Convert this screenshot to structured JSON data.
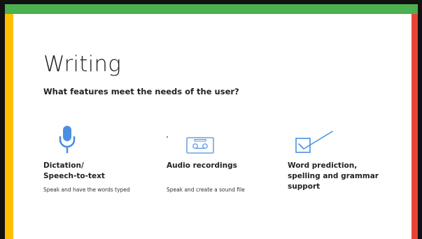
{
  "slide": {
    "title": "Writing",
    "subtitle": "What features meet the needs of the user?"
  },
  "features": [
    {
      "icon": "microphone-icon",
      "title_line1": "Dictation/",
      "title_line2": "Speech-to-text",
      "description": "Speak and have the words typed"
    },
    {
      "icon": "cassette-icon",
      "title_line1": "Audio recordings",
      "title_line2": "",
      "description": "Speak and create a sound file"
    },
    {
      "icon": "checkbox-icon",
      "title_line1": "Word prediction,",
      "title_line2": "spelling and grammar",
      "title_line3": "support",
      "description": ""
    }
  ],
  "colors": {
    "top_bar": "#4caf50",
    "left_bar": "#ffbf00",
    "right_bar": "#ea4335",
    "icon_blue": "#4a90e2"
  }
}
